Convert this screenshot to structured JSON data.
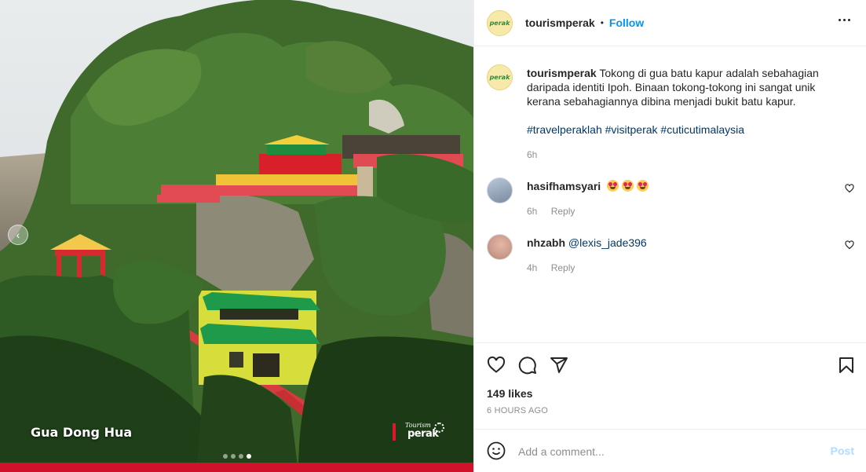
{
  "media": {
    "caption": "Gua Dong Hua",
    "brand_script": "Tourism",
    "brand_name": "perak",
    "prev_icon": "chevron-left-icon",
    "carousel_total": 4,
    "carousel_active": 4
  },
  "post": {
    "username": "tourismperak",
    "separator": "•",
    "follow_label": "Follow",
    "avatar_text": "perak",
    "caption_body": "Tokong di gua batu kapur adalah sebahagian daripada identiti Ipoh. Binaan tokong-tokong ini sangat unik kerana sebahagiannya dibina menjadi bukit batu kapur.",
    "hashtags": "#travelperaklah #visitperak #cuticutimalaysia",
    "caption_time": "6h"
  },
  "comments": [
    {
      "username": "hasifhamsyari",
      "emoji_count": 3,
      "time": "6h",
      "reply_label": "Reply"
    },
    {
      "username": "nhzabh",
      "text": "@lexis_jade396",
      "time": "4h",
      "reply_label": "Reply"
    }
  ],
  "actions": {
    "likes": "149 likes",
    "time_ago": "6 HOURS AGO"
  },
  "add_comment": {
    "placeholder": "Add a comment...",
    "post_label": "Post"
  },
  "colors": {
    "accent": "#0095f6",
    "post_disabled": "#b3dbff",
    "link": "#00376b",
    "muted": "#8e8e8e"
  }
}
